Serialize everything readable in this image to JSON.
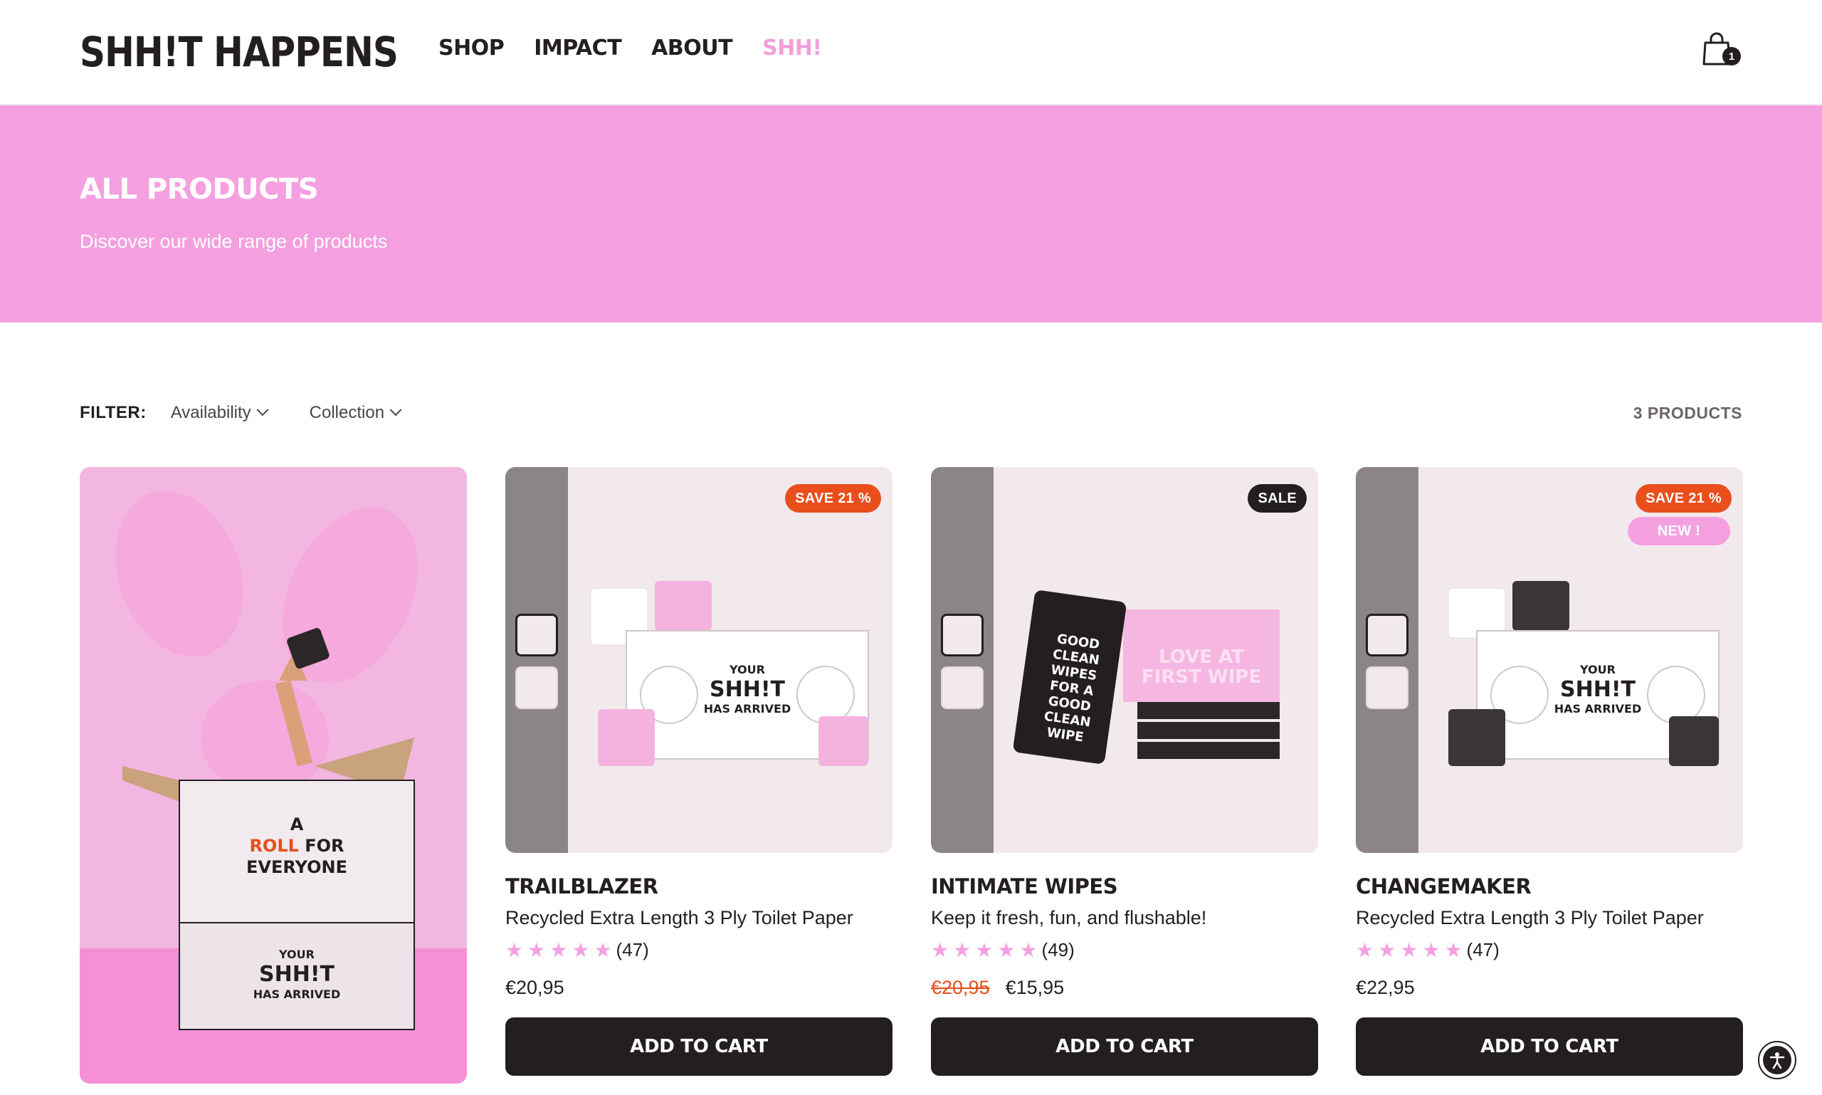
{
  "header": {
    "logo": "SHH!T HAPPENS",
    "nav": [
      "SHOP",
      "IMPACT",
      "ABOUT",
      "SHH!"
    ],
    "cart_count": "1"
  },
  "hero": {
    "title": "ALL PRODUCTS",
    "subtitle": "Discover our wide range of products"
  },
  "filter": {
    "label": "FILTER:",
    "availability": "Availability",
    "collection": "Collection",
    "count": "3 PRODUCTS"
  },
  "promo": {
    "box_text_top": "A ROLL FOR EVERYONE",
    "box_text_bottom": "YOUR SHH!T HAS ARRIVED"
  },
  "products": [
    {
      "name": "TRAILBLAZER",
      "desc": "Recycled Extra Length 3 Ply Toilet Paper",
      "reviews": "(47)",
      "rating": 5,
      "price": "€20,95",
      "badges": [
        "SAVE 21 %"
      ],
      "cta": "ADD TO CART",
      "image_text": "YOUR SHH!T HAS ARRIVED"
    },
    {
      "name": "INTIMATE WIPES",
      "desc": "Keep it fresh, fun, and flushable!",
      "reviews": "(49)",
      "rating": 5,
      "old_price": "€20,95",
      "price": "€15,95",
      "badges": [
        "SALE"
      ],
      "cta": "ADD TO CART",
      "image_text": "LOVE AT FIRST WIPE",
      "pack_text": "GOOD CLEAN WIPES FOR A GOOD CLEAN WIPE"
    },
    {
      "name": "CHANGEMAKER",
      "desc": "Recycled Extra Length 3 Ply Toilet Paper",
      "reviews": "(47)",
      "rating": 5,
      "price": "€22,95",
      "badges": [
        "SAVE 21 %",
        "NEW !"
      ],
      "cta": "ADD TO CART",
      "image_text": "YOUR SHH!T HAS ARRIVED"
    }
  ],
  "colors": {
    "pink": "#f4a0e0",
    "dark": "#231f20",
    "orange": "#e94e1b"
  }
}
